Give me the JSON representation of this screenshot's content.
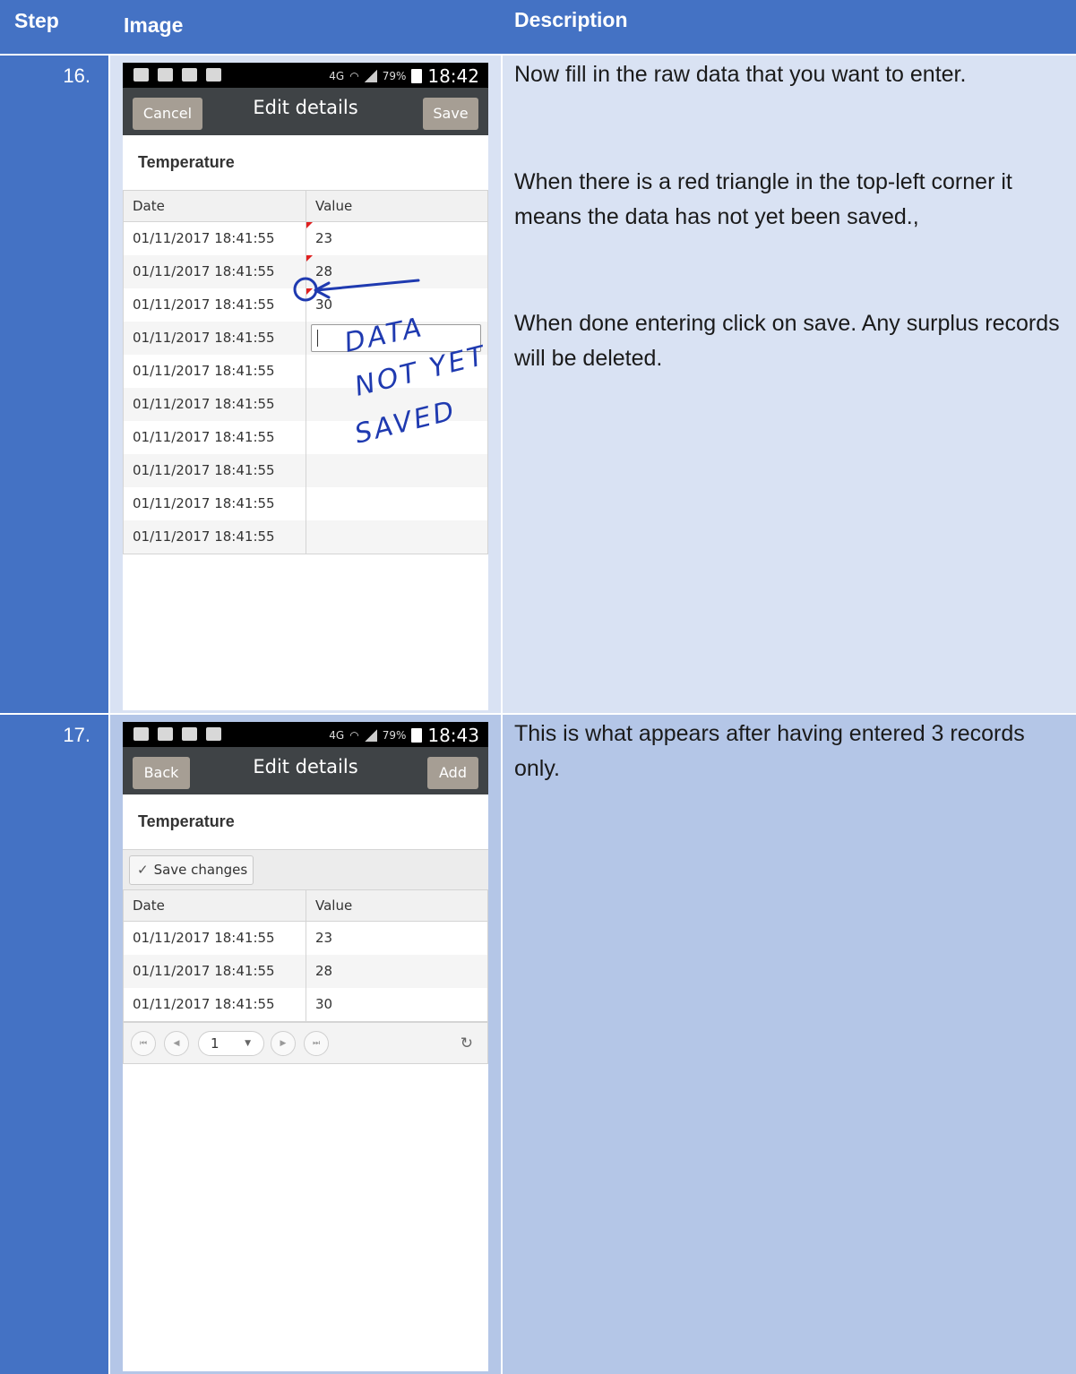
{
  "header": {
    "step": "Step",
    "image": "Image",
    "description": "Description"
  },
  "rows": [
    {
      "step": "16.",
      "screen": {
        "time": "18:42",
        "battery": "79%",
        "net": "4G",
        "title": "Edit details",
        "left_button": "Cancel",
        "right_button": "Save",
        "grid_title": "Temperature",
        "col_date": "Date",
        "col_value": "Value",
        "records": [
          {
            "date": "01/11/2017 18:41:55",
            "value": "23"
          },
          {
            "date": "01/11/2017 18:41:55",
            "value": "28"
          },
          {
            "date": "01/11/2017 18:41:55",
            "value": "30"
          },
          {
            "date": "01/11/2017 18:41:55",
            "value": ""
          },
          {
            "date": "01/11/2017 18:41:55",
            "value": ""
          },
          {
            "date": "01/11/2017 18:41:55",
            "value": ""
          },
          {
            "date": "01/11/2017 18:41:55",
            "value": ""
          },
          {
            "date": "01/11/2017 18:41:55",
            "value": ""
          },
          {
            "date": "01/11/2017 18:41:55",
            "value": ""
          },
          {
            "date": "01/11/2017 18:41:55",
            "value": ""
          }
        ],
        "annotation": [
          "DATA",
          "NOT YET",
          "SAVED"
        ]
      },
      "description": [
        "Now fill in the raw data that you want to enter.",
        "When there is a red triangle in the top-left corner it means the data has not yet been saved.,",
        "When done entering click on save. Any surplus records will be deleted."
      ]
    },
    {
      "step": "17.",
      "screen": {
        "time": "18:43",
        "battery": "79%",
        "net": "4G",
        "title": "Edit details",
        "left_button": "Back",
        "right_button": "Add",
        "grid_title": "Temperature",
        "toolbar_button": "Save changes",
        "col_date": "Date",
        "col_value": "Value",
        "records": [
          {
            "date": "01/11/2017 18:41:55",
            "value": "23"
          },
          {
            "date": "01/11/2017 18:41:55",
            "value": "28"
          },
          {
            "date": "01/11/2017 18:41:55",
            "value": "30"
          }
        ],
        "pager_page": "1"
      },
      "description": [
        "This is what appears after having entered 3 records only."
      ]
    }
  ],
  "colors": {
    "header": "#4472c4",
    "row_light": "#d9e2f3",
    "row_dark": "#b4c6e7",
    "ink": "#1f3ab0",
    "dirty_marker": "#e02020"
  }
}
